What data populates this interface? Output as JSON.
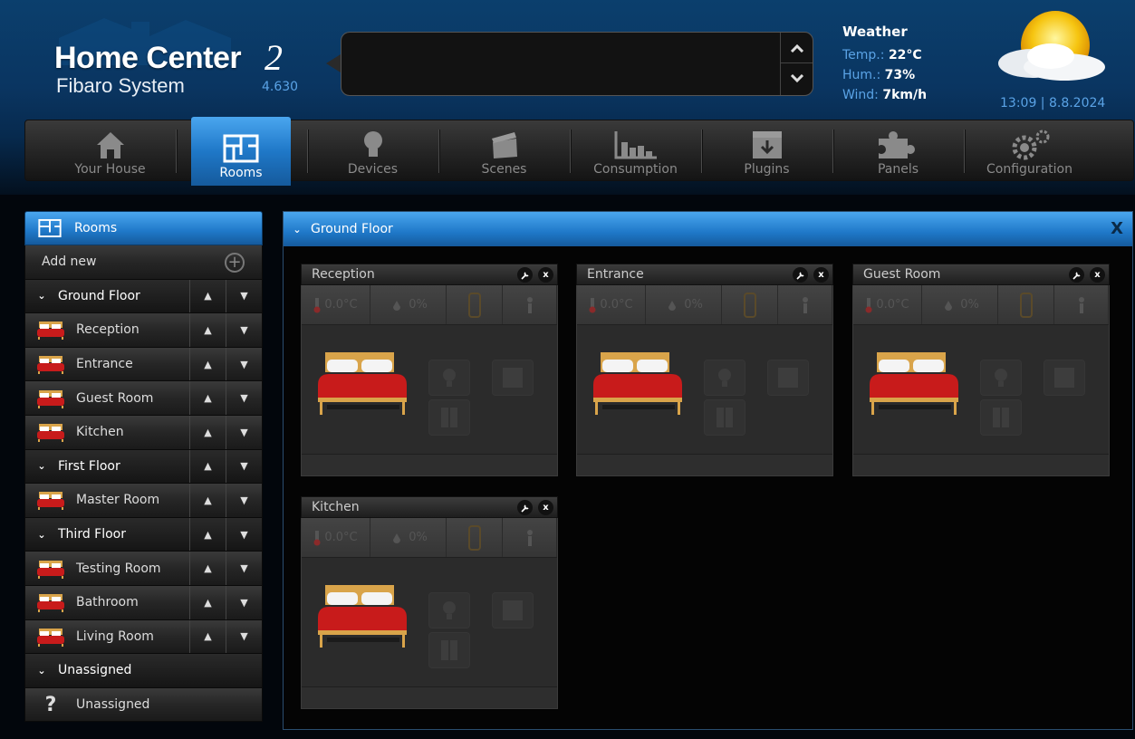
{
  "app": {
    "title": "Home Center",
    "title_num": "2",
    "subtitle": "Fibaro System",
    "version": "4.630"
  },
  "weather": {
    "title": "Weather",
    "temp_label": "Temp.:",
    "temp_value": "22°C",
    "hum_label": "Hum.:",
    "hum_value": "73%",
    "wind_label": "Wind:",
    "wind_value": "7km/h",
    "clock": "13:09 | 8.8.2024"
  },
  "nav": {
    "your_house": "Your House",
    "rooms": "Rooms",
    "devices": "Devices",
    "scenes": "Scenes",
    "consumption": "Consumption",
    "plugins": "Plugins",
    "panels": "Panels",
    "configuration": "Configuration"
  },
  "sidebar": {
    "header": "Rooms",
    "add_new": "Add new",
    "rows": [
      {
        "label": "Ground Floor"
      },
      {
        "label": "Reception"
      },
      {
        "label": "Entrance"
      },
      {
        "label": "Guest Room"
      },
      {
        "label": "Kitchen"
      },
      {
        "label": "First Floor"
      },
      {
        "label": "Master Room"
      },
      {
        "label": "Third Floor"
      },
      {
        "label": "Testing Room"
      },
      {
        "label": "Bathroom"
      },
      {
        "label": "Living Room"
      },
      {
        "label": "Unassigned"
      },
      {
        "label": "Unassigned"
      }
    ]
  },
  "main": {
    "section_title": "Ground Floor",
    "close_label": "X",
    "rooms": [
      {
        "name": "Reception",
        "temp": "0.0°C",
        "hum": "0%"
      },
      {
        "name": "Entrance",
        "temp": "0.0°C",
        "hum": "0%"
      },
      {
        "name": "Guest Room",
        "temp": "0.0°C",
        "hum": "0%"
      },
      {
        "name": "Kitchen",
        "temp": "0.0°C",
        "hum": "0%"
      }
    ],
    "close_x": "x"
  },
  "colors": {
    "accent_blue": "#1f78c8",
    "label_blue": "#5aa3e6",
    "bed_red": "#c81b1b"
  }
}
